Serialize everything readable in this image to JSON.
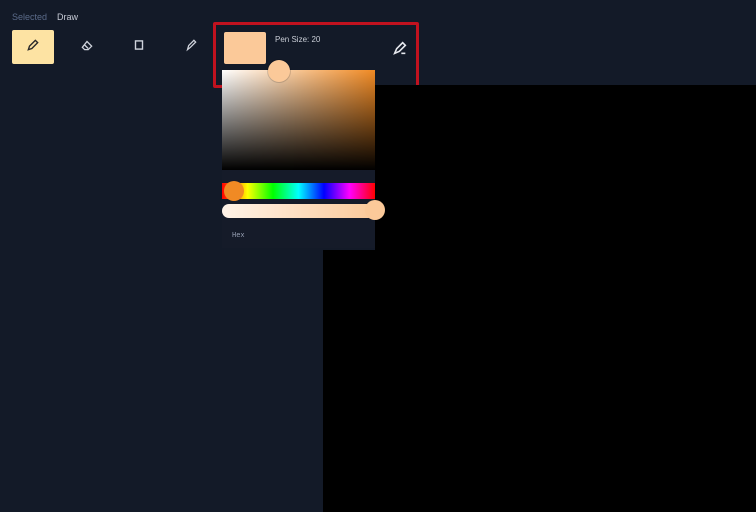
{
  "tabs": {
    "selected": "Selected",
    "draw": "Draw"
  },
  "tools": [
    {
      "name": "pen",
      "icon": "pencil-icon",
      "active": true
    },
    {
      "name": "eraser",
      "icon": "eraser-icon",
      "active": false
    },
    {
      "name": "shape",
      "icon": "square-icon",
      "active": false
    },
    {
      "name": "marker",
      "icon": "brush-icon",
      "active": false
    }
  ],
  "pen": {
    "size_label": "Pen Size: 20",
    "color": "#fbc999"
  },
  "picker": {
    "hue_color": "#f08a24",
    "hex_label": "Hex"
  },
  "colors": {
    "background": "#131a28",
    "canvas": "#000000",
    "accent": "#fde3a3",
    "highlight": "#c1121f"
  }
}
